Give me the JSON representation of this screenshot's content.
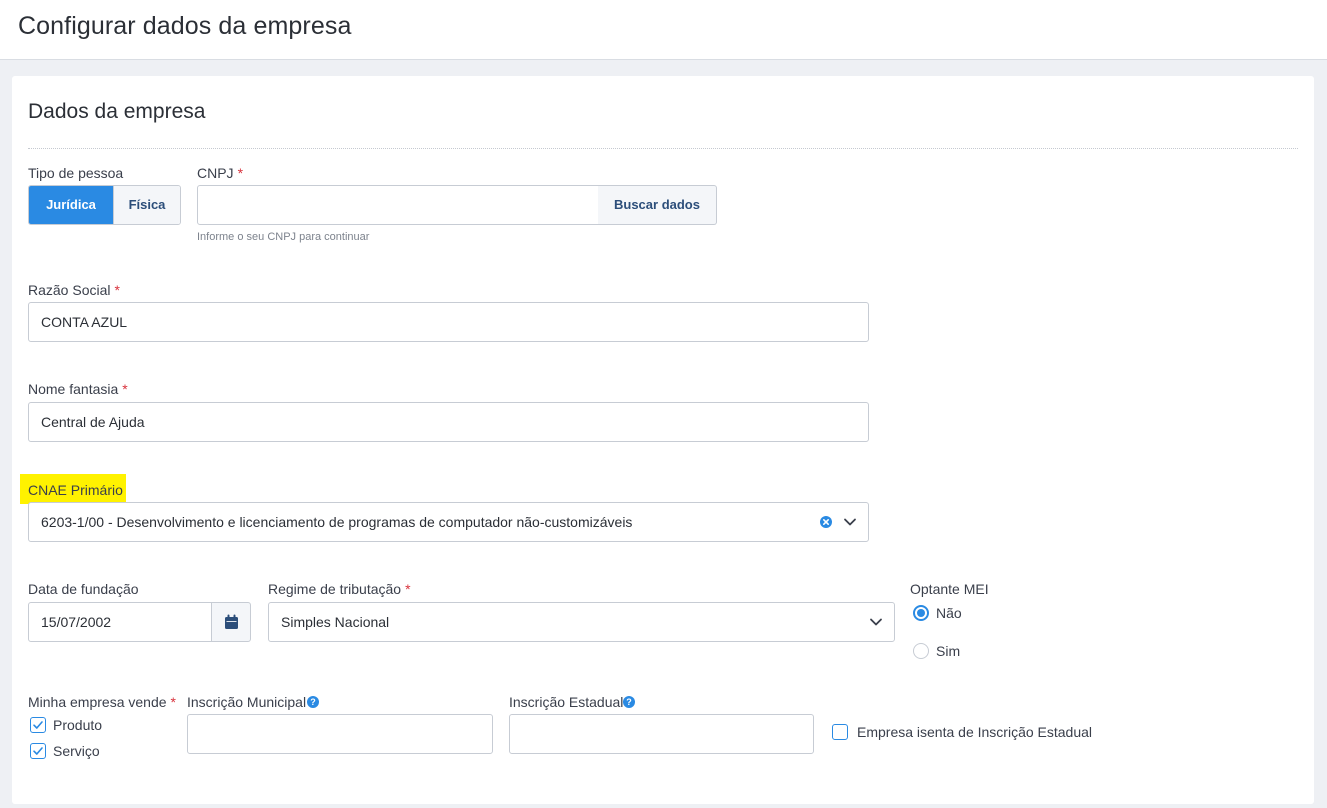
{
  "header": {
    "title": "Configurar dados da empresa"
  },
  "section": {
    "title": "Dados da empresa"
  },
  "tipo_pessoa": {
    "label": "Tipo de pessoa",
    "options": [
      "Jurídica",
      "Física"
    ],
    "selected": "Jurídica"
  },
  "cnpj": {
    "label": "CNPJ",
    "required_mark": "*",
    "value": "",
    "button_label": "Buscar dados",
    "help": "Informe o seu CNPJ para continuar"
  },
  "razao_social": {
    "label": "Razão Social",
    "required_mark": "*",
    "value": "CONTA AZUL"
  },
  "nome_fantasia": {
    "label": "Nome fantasia",
    "required_mark": "*",
    "value": "Central de Ajuda"
  },
  "cnae": {
    "label": "CNAE Primário",
    "value": "6203-1/00 - Desenvolvimento e licenciamento de programas de computador não-customizáveis",
    "highlight_color": "#fff200"
  },
  "data_fundacao": {
    "label": "Data de fundação",
    "value": "15/07/2002"
  },
  "regime": {
    "label": "Regime de tributação",
    "required_mark": "*",
    "value": "Simples Nacional"
  },
  "mei": {
    "label": "Optante MEI",
    "options": [
      "Não",
      "Sim"
    ],
    "selected": "Não"
  },
  "vende": {
    "label": "Minha empresa vende",
    "required_mark": "*",
    "options": [
      {
        "label": "Produto",
        "checked": true
      },
      {
        "label": "Serviço",
        "checked": true
      }
    ]
  },
  "inscricao_municipal": {
    "label": "Inscrição Municipal",
    "value": ""
  },
  "inscricao_estadual": {
    "label": "Inscrição Estadual",
    "value": ""
  },
  "isenta": {
    "label": "Empresa isenta de Inscrição Estadual",
    "checked": false
  },
  "colors": {
    "accent": "#2a8ae3",
    "required": "#d8323c",
    "button_text": "#2c4e7a"
  }
}
